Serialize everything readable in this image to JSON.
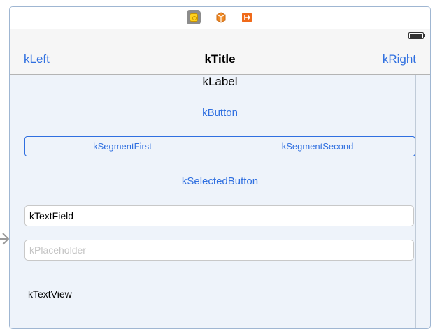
{
  "scene": {
    "dock_icons": [
      "view-controller-icon",
      "first-responder-icon",
      "exit-icon"
    ]
  },
  "status_bar": {
    "icons": [
      "battery-icon"
    ]
  },
  "nav_bar": {
    "left_item": "kLeft",
    "title": "kTitle",
    "right_item": "kRight"
  },
  "content": {
    "label": "kLabel",
    "button": "kButton",
    "segmented_control": {
      "segments": [
        "kSegmentFirst",
        "kSegmentSecond"
      ]
    },
    "selected_button": "kSelectedButton",
    "text_field_value": "kTextField",
    "placeholder_field_placeholder": "kPlaceholder",
    "text_view": "kTextView"
  },
  "colors": {
    "tint": "#2f6fe0",
    "scene_background": "#eef3fa",
    "nav_background": "#f6f6f6",
    "placeholder": "#c4c4c4"
  }
}
